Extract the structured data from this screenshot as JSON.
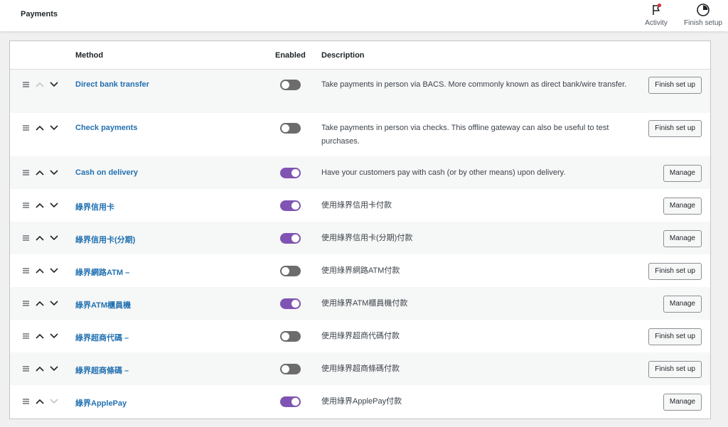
{
  "header": {
    "title": "Payments",
    "activity_label": "Activity",
    "finish_setup_label": "Finish setup",
    "activity_badge_color": "#d63638"
  },
  "table": {
    "columns": {
      "method": "Method",
      "enabled": "Enabled",
      "description": "Description"
    },
    "rows": [
      {
        "method": "Direct bank transfer",
        "enabled": false,
        "description": "Take payments in person via BACS. More commonly known as direct bank/wire transfer.",
        "action": "Finish set up",
        "up_disabled": true,
        "down_disabled": false
      },
      {
        "method": "Check payments",
        "enabled": false,
        "description": "Take payments in person via checks. This offline gateway can also be useful to test purchases.",
        "action": "Finish set up",
        "up_disabled": false,
        "down_disabled": false
      },
      {
        "method": "Cash on delivery",
        "enabled": true,
        "description": "Have your customers pay with cash (or by other means) upon delivery.",
        "action": "Manage",
        "up_disabled": false,
        "down_disabled": false
      },
      {
        "method": "綠界信用卡",
        "enabled": true,
        "description": "使用綠界信用卡付款",
        "action": "Manage",
        "up_disabled": false,
        "down_disabled": false
      },
      {
        "method": "綠界信用卡(分期)",
        "enabled": true,
        "description": "使用綠界信用卡(分期)付款",
        "action": "Manage",
        "up_disabled": false,
        "down_disabled": false
      },
      {
        "method": "綠界網路ATM –",
        "enabled": false,
        "description": "使用綠界網路ATM付款",
        "action": "Finish set up",
        "up_disabled": false,
        "down_disabled": false
      },
      {
        "method": "綠界ATM櫃員機",
        "enabled": true,
        "description": "使用綠界ATM櫃員機付款",
        "action": "Manage",
        "up_disabled": false,
        "down_disabled": false
      },
      {
        "method": "綠界超商代碼 –",
        "enabled": false,
        "description": "使用綠界超商代碼付款",
        "action": "Finish set up",
        "up_disabled": false,
        "down_disabled": false
      },
      {
        "method": "綠界超商條碼 –",
        "enabled": false,
        "description": "使用綠界超商條碼付款",
        "action": "Finish set up",
        "up_disabled": false,
        "down_disabled": false
      },
      {
        "method": "綠界ApplePay",
        "enabled": true,
        "description": "使用綠界ApplePay付款",
        "action": "Manage",
        "up_disabled": false,
        "down_disabled": true
      }
    ]
  },
  "colors": {
    "link": "#2271b1",
    "toggle_on": "#7f54b3",
    "toggle_off": "#6c6c6c"
  },
  "icons": {
    "drag": "drag-handle-icon",
    "up": "chevron-up-icon",
    "down": "chevron-down-icon",
    "activity": "flag-icon",
    "finish_setup": "progress-circle-icon"
  }
}
